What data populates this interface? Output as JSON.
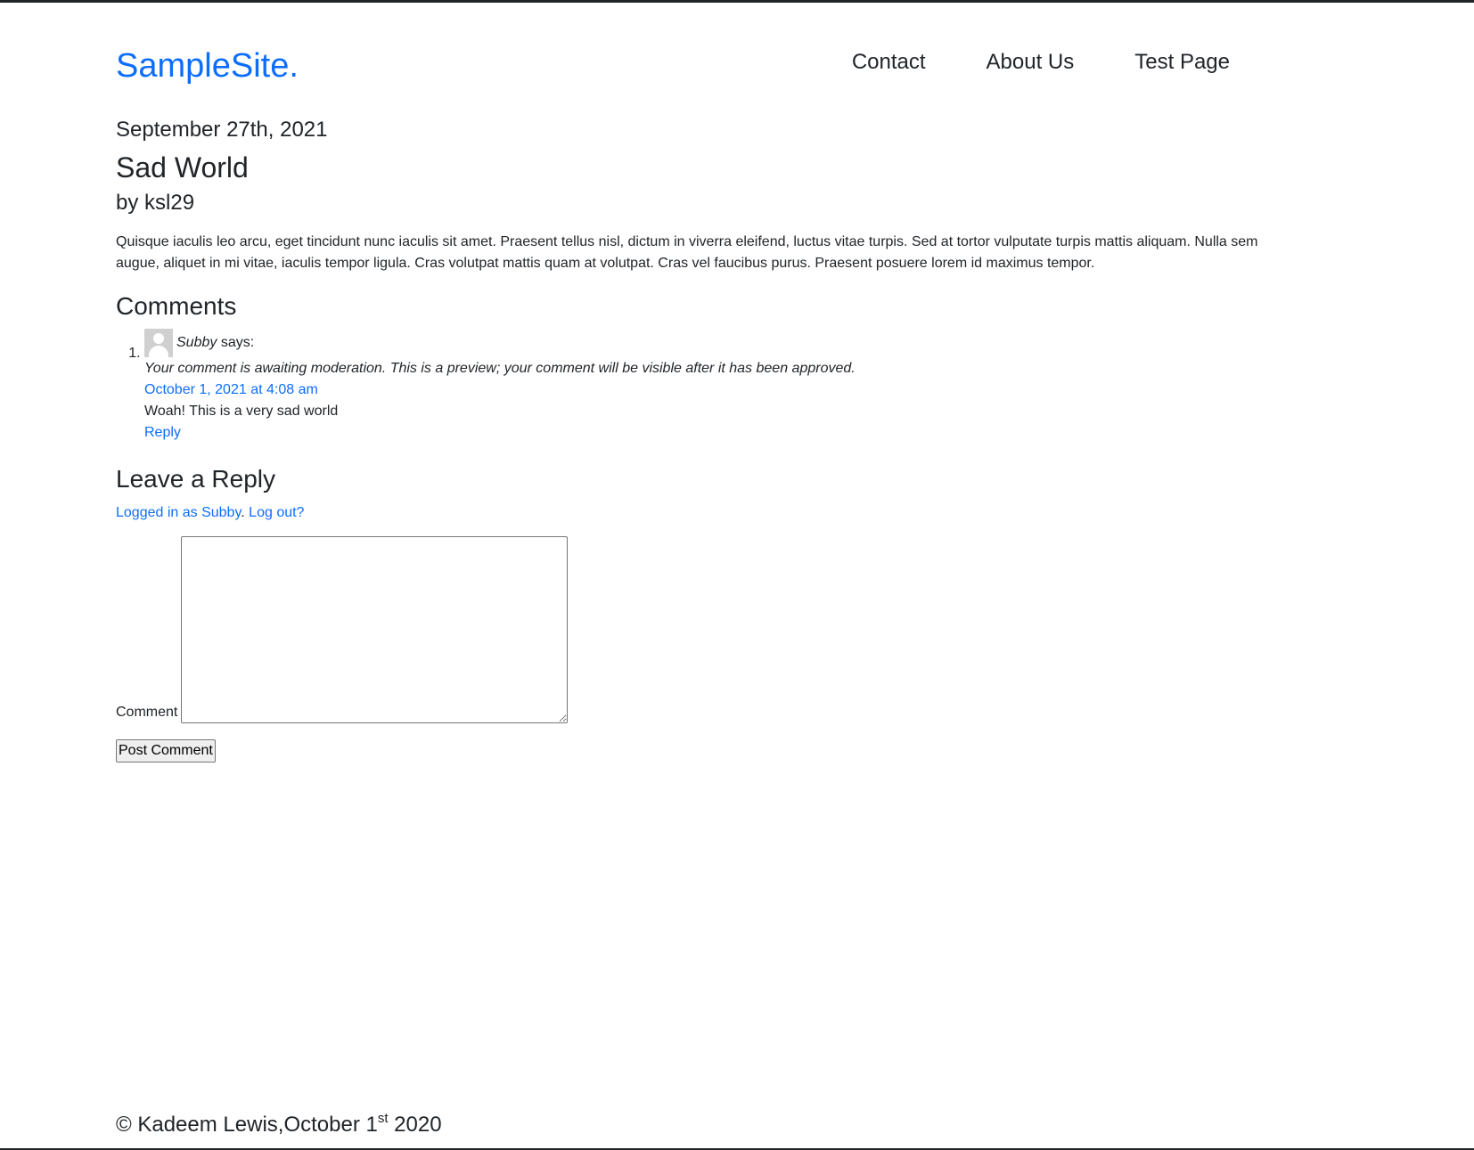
{
  "colors": {
    "link": "#0d6efd",
    "text": "#212529",
    "rule": "#212529"
  },
  "header": {
    "brand": "SampleSite.",
    "nav": [
      {
        "label": "Contact"
      },
      {
        "label": "About Us"
      },
      {
        "label": "Test Page"
      }
    ]
  },
  "post": {
    "date": "September 27th, 2021",
    "title": "Sad World",
    "author": "by ksl29",
    "body": "Quisque iaculis leo arcu, eget tincidunt nunc iaculis sit amet. Praesent tellus nisl, dictum in viverra eleifend, luctus vitae turpis. Sed at tortor vulputate turpis mattis aliquam. Nulla sem augue, aliquet in mi vitae, iaculis tempor ligula. Cras volutpat mattis quam at volutpat. Cras vel faucibus purus. Praesent posuere lorem id maximus tempor."
  },
  "comments": {
    "heading": "Comments",
    "items": [
      {
        "number": "1.",
        "author": "Subby",
        "says": "says:",
        "avatar_icon": "default-avatar-icon",
        "moderation": "Your comment is awaiting moderation. This is a preview; your comment will be visible after it has been approved.",
        "timestamp": "October 1, 2021 at 4:08 am",
        "text": "Woah! This is a very sad world",
        "reply_label": "Reply"
      }
    ]
  },
  "reply_form": {
    "heading": "Leave a Reply",
    "logged_in_text": "Logged in as Subby",
    "separator": ".",
    "logout_text": "Log out?",
    "comment_label": "Comment",
    "comment_value": "",
    "submit_label": "Post Comment"
  },
  "footer": {
    "text_before": "© Kadeem Lewis,October 1",
    "superscript": "st",
    "text_after": " 2020"
  }
}
